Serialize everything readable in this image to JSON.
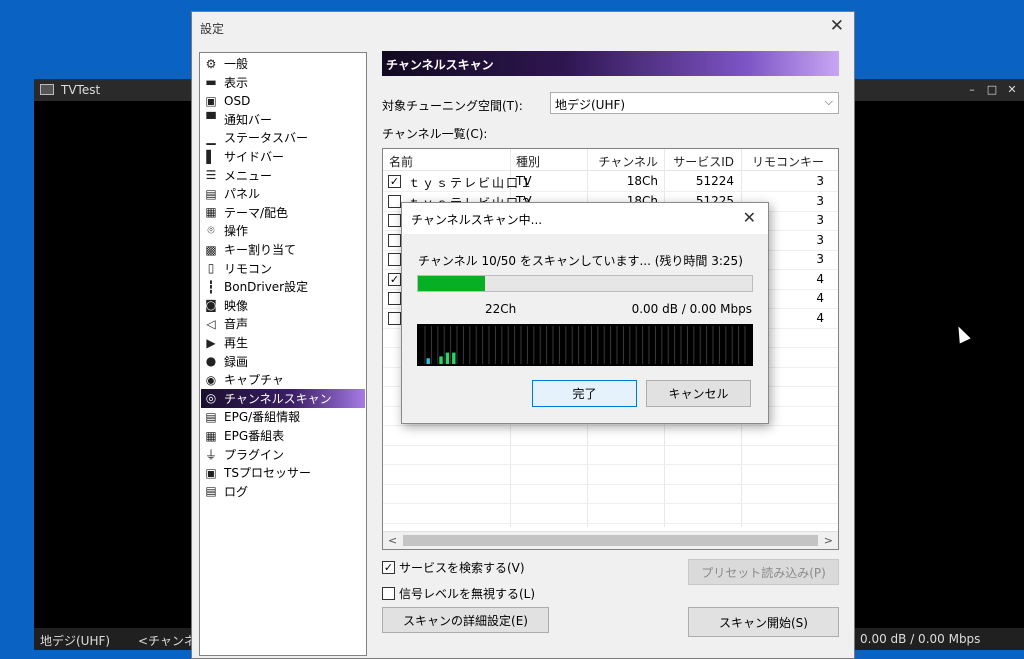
{
  "background_window": {
    "title": "TVTest",
    "controls": [
      "–",
      "□",
      "✕"
    ],
    "status_left": "地デジ(UHF)",
    "status_mid": "<チャンネル",
    "status_right": "0.00 dB / 0.00 Mbps"
  },
  "settings": {
    "title": "設定",
    "close": "✕",
    "categories": [
      {
        "label": "一般",
        "icon": "gear-icon",
        "glyph": "⚙"
      },
      {
        "label": "表示",
        "icon": "display-icon",
        "glyph": "▬"
      },
      {
        "label": "OSD",
        "icon": "osd-icon",
        "glyph": "▣"
      },
      {
        "label": "通知バー",
        "icon": "notification-bar-icon",
        "glyph": "▀"
      },
      {
        "label": "ステータスバー",
        "icon": "status-bar-icon",
        "glyph": "▁"
      },
      {
        "label": "サイドバー",
        "icon": "side-bar-icon",
        "glyph": "▌"
      },
      {
        "label": "メニュー",
        "icon": "menu-icon",
        "glyph": "☰"
      },
      {
        "label": "パネル",
        "icon": "panel-icon",
        "glyph": "▤"
      },
      {
        "label": "テーマ/配色",
        "icon": "theme-icon",
        "glyph": "▦"
      },
      {
        "label": "操作",
        "icon": "mouse-icon",
        "glyph": "⌾"
      },
      {
        "label": "キー割り当て",
        "icon": "keyboard-icon",
        "glyph": "▩"
      },
      {
        "label": "リモコン",
        "icon": "remote-icon",
        "glyph": "▯"
      },
      {
        "label": "BonDriver設定",
        "icon": "bondriver-icon",
        "glyph": "┇"
      },
      {
        "label": "映像",
        "icon": "video-camera-icon",
        "glyph": "◙"
      },
      {
        "label": "音声",
        "icon": "speaker-icon",
        "glyph": "◁"
      },
      {
        "label": "再生",
        "icon": "play-icon",
        "glyph": "▶"
      },
      {
        "label": "録画",
        "icon": "record-icon",
        "glyph": "●"
      },
      {
        "label": "キャプチャ",
        "icon": "camera-icon",
        "glyph": "◉"
      },
      {
        "label": "チャンネルスキャン",
        "icon": "channel-scan-icon",
        "glyph": "◎"
      },
      {
        "label": "EPG/番組情報",
        "icon": "epg-info-icon",
        "glyph": "▤"
      },
      {
        "label": "EPG番組表",
        "icon": "program-table-icon",
        "glyph": "▦"
      },
      {
        "label": "プラグイン",
        "icon": "plugin-icon",
        "glyph": "⏚"
      },
      {
        "label": "TSプロセッサー",
        "icon": "ts-processor-icon",
        "glyph": "▣"
      },
      {
        "label": "ログ",
        "icon": "log-icon",
        "glyph": "▤"
      }
    ],
    "selected_category": 18,
    "section_title": "チャンネルスキャン",
    "tuning_space_label": "対象チューニング空間(T):",
    "tuning_space_value": "地デジ(UHF)",
    "channel_list_label": "チャンネル一覧(C):",
    "columns": [
      "名前",
      "種別",
      "チャンネル",
      "サービスID",
      "リモコンキー"
    ],
    "rows": [
      {
        "checked": true,
        "name": "ｔｙｓテレビ山口１",
        "type": "TV",
        "channel": "18Ch",
        "service_id": "51224",
        "remote_key": "3"
      },
      {
        "checked": false,
        "name": "ｔｙｓテレビ山口２",
        "type": "TV",
        "channel": "18Ch",
        "service_id": "51225",
        "remote_key": "3"
      },
      {
        "checked": false,
        "name": "",
        "type": "",
        "channel": "",
        "service_id": "",
        "remote_key": "3"
      },
      {
        "checked": false,
        "name": "",
        "type": "",
        "channel": "",
        "service_id": "",
        "remote_key": "3"
      },
      {
        "checked": false,
        "name": "",
        "type": "",
        "channel": "",
        "service_id": "",
        "remote_key": "3"
      },
      {
        "checked": true,
        "name": "",
        "type": "",
        "channel": "",
        "service_id": "",
        "remote_key": "4"
      },
      {
        "checked": false,
        "name": "",
        "type": "",
        "channel": "",
        "service_id": "",
        "remote_key": "4"
      },
      {
        "checked": false,
        "name": "",
        "type": "",
        "channel": "",
        "service_id": "",
        "remote_key": "4"
      }
    ],
    "scroll_left": "<",
    "scroll_right": ">",
    "search_services": {
      "label": "サービスを検索する(V)",
      "checked": true
    },
    "ignore_signal": {
      "label": "信号レベルを無視する(L)",
      "checked": false
    },
    "preset_button": "プリセット読み込み(P)",
    "detail_button": "スキャンの詳細設定(E)",
    "start_button": "スキャン開始(S)"
  },
  "scan_dialog": {
    "title": "チャンネルスキャン中...",
    "close": "✕",
    "message": "チャンネル 10/50 をスキャンしています... (残り時間 3:25)",
    "progress": 0.2,
    "channel": "22Ch",
    "level": "0.00 dB / 0.00 Mbps",
    "signal_levels": [
      0.15,
      0,
      0.2,
      0.3,
      0.3,
      0,
      0,
      0,
      0,
      0,
      0,
      0,
      0,
      0,
      0,
      0,
      0,
      0,
      0,
      0,
      0,
      0,
      0,
      0,
      0,
      0,
      0,
      0,
      0,
      0,
      0,
      0,
      0,
      0,
      0,
      0,
      0,
      0,
      0,
      0,
      0,
      0,
      0,
      0,
      0,
      0,
      0,
      0,
      0,
      0
    ],
    "finish_button": "完了",
    "cancel_button": "キャンセル",
    "colors": {
      "progress": "#06b025",
      "bar_low": "#2ec4d6",
      "bar_high": "#2fd36a"
    }
  }
}
